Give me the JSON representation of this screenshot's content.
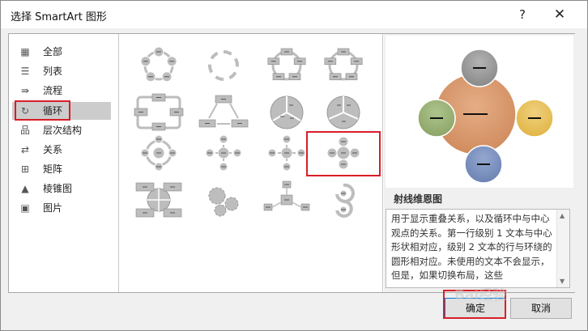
{
  "window": {
    "title": "选择 SmartArt 图形",
    "help": "?",
    "close": "✕"
  },
  "categories": [
    {
      "label": "全部",
      "icon": "all-icon",
      "glyph": "▦"
    },
    {
      "label": "列表",
      "icon": "list-icon",
      "glyph": "☰"
    },
    {
      "label": "流程",
      "icon": "process-icon",
      "glyph": "⇛"
    },
    {
      "label": "循环",
      "icon": "cycle-icon",
      "glyph": "↻",
      "selected": true
    },
    {
      "label": "层次结构",
      "icon": "hierarchy-icon",
      "glyph": "品"
    },
    {
      "label": "关系",
      "icon": "relationship-icon",
      "glyph": "⇄"
    },
    {
      "label": "矩阵",
      "icon": "matrix-icon",
      "glyph": "⊞"
    },
    {
      "label": "棱锥图",
      "icon": "pyramid-icon",
      "glyph": "▲"
    },
    {
      "label": "图片",
      "icon": "picture-icon",
      "glyph": "▣"
    }
  ],
  "gallery": {
    "selected_index": 11,
    "tiles": [
      "basic-cycle",
      "text-cycle",
      "block-cycle",
      "nondirectional-cycle",
      "continuous-cycle",
      "multidirectional-cycle",
      "segmented-cycle",
      "basic-pie",
      "hexagon-radial",
      "basic-radial",
      "diverging-radial",
      "radial-venn",
      "cycle-matrix",
      "gear",
      "radial-cluster",
      "circle-arrow-process"
    ]
  },
  "preview": {
    "title": "射线维恩图",
    "description": "用于显示重叠关系，以及循环中与中心观点的关系。第一行级别 1 文本与中心形状相对应，级别 2 文本的行与环绕的圆形相对应。未使用的文本不会显示，但是，如果切换布局，这些",
    "center_color": "#d08c5e",
    "top_color": "#8c8c8c",
    "left_color": "#8fa86a",
    "right_color": "#e2b84a",
    "bottom_color": "#6f86b6",
    "dash": "—"
  },
  "buttons": {
    "ok": "确定",
    "cancel": "取消"
  },
  "watermark": "Bai经验"
}
